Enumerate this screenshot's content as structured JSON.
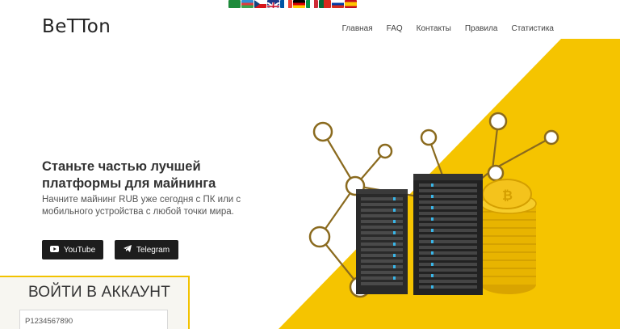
{
  "header": {
    "logo": "BeTTon",
    "nav": [
      "Главная",
      "FAQ",
      "Контакты",
      "Правила",
      "Статистика"
    ]
  },
  "flags": [
    "ar",
    "az",
    "cz",
    "gb",
    "fr",
    "de",
    "it",
    "pt",
    "ru",
    "es"
  ],
  "hero": {
    "title": "Станьте частью лучшей платформы для майнинга",
    "subtitle": "Начните майнинг RUB уже сегодня с ПК или с мобильного устройства с любой точки мира."
  },
  "buttons": {
    "youtube": "YouTube",
    "telegram": "Telegram"
  },
  "login": {
    "title": "ВОЙТИ В АККАУНТ",
    "input_value": "P1234567890"
  },
  "colors": {
    "accent": "#f5c400",
    "dark": "#1d1d1d"
  }
}
